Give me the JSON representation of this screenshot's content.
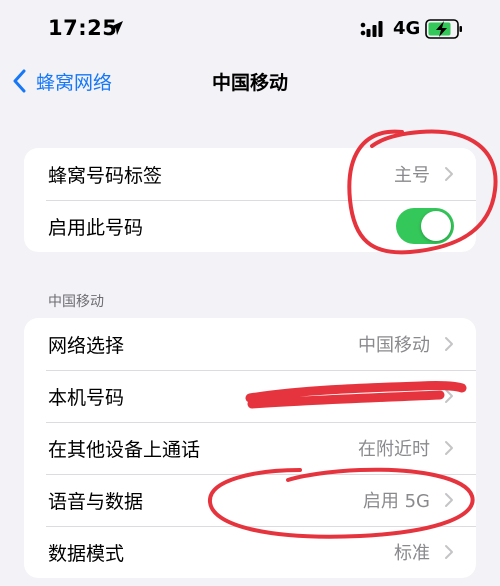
{
  "status_bar": {
    "time": "17:25",
    "network": "4G",
    "icons": [
      "location-arrow-icon",
      "cellular-signal-icon",
      "battery-charging-icon"
    ]
  },
  "nav": {
    "back_label": "蜂窝网络",
    "title": "中国移动"
  },
  "group1": {
    "rows": [
      {
        "label": "蜂窝号码标签",
        "value": "主号"
      },
      {
        "label": "启用此号码",
        "toggle_on": true
      }
    ]
  },
  "section": {
    "header": "中国移动"
  },
  "group2": {
    "rows": [
      {
        "label": "网络选择",
        "value": "中国移动"
      },
      {
        "label": "本机号码",
        "value": ""
      },
      {
        "label": "在其他设备上通话",
        "value": "在附近时"
      },
      {
        "label": "语音与数据",
        "value": "启用 5G"
      },
      {
        "label": "数据模式",
        "value": "标准"
      }
    ]
  },
  "colors": {
    "accent": "#1677f7",
    "toggle_on": "#34c759",
    "annotation_red": "#e5343d",
    "background": "#f2f2f7"
  }
}
